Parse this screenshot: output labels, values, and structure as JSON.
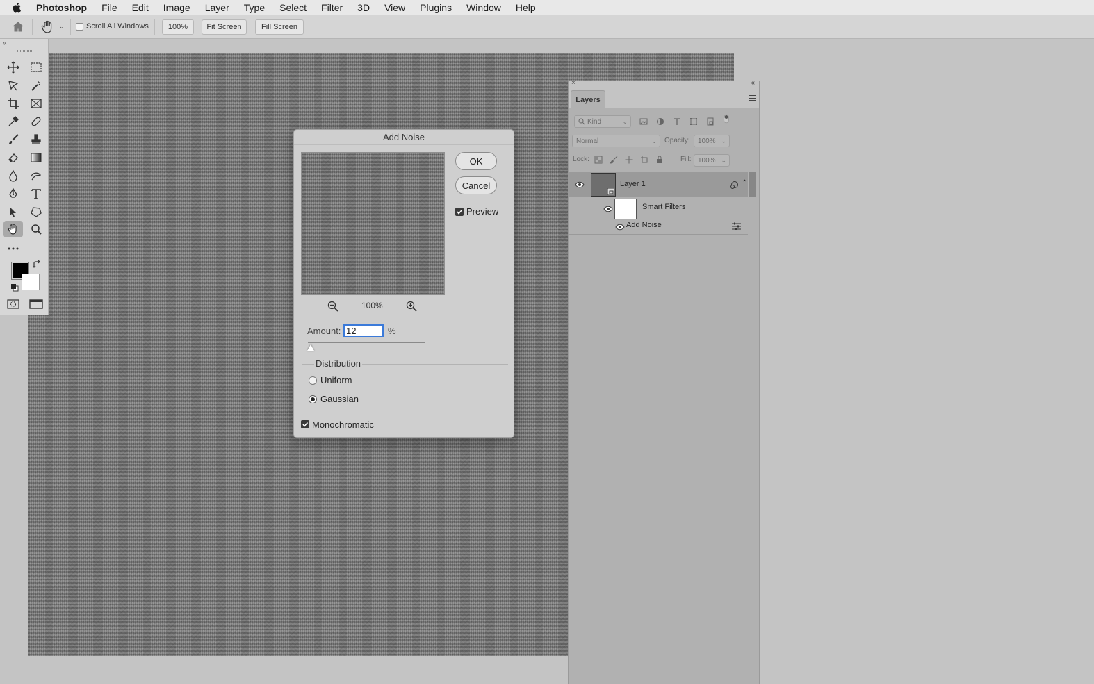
{
  "menubar": {
    "app_name": "Photoshop",
    "items": [
      "File",
      "Edit",
      "Image",
      "Layer",
      "Type",
      "Select",
      "Filter",
      "3D",
      "View",
      "Plugins",
      "Window",
      "Help"
    ]
  },
  "optionsbar": {
    "scroll_all_windows": "Scroll All Windows",
    "zoom_100": "100%",
    "fit_screen": "Fit Screen",
    "fill_screen": "Fill Screen"
  },
  "dialog": {
    "title": "Add Noise",
    "ok": "OK",
    "cancel": "Cancel",
    "preview": "Preview",
    "zoom_level": "100%",
    "amount_label": "Amount:",
    "amount_value": "12",
    "amount_unit": "%",
    "distribution_label": "Distribution",
    "uniform": "Uniform",
    "gaussian": "Gaussian",
    "selected_distribution": "Gaussian",
    "monochromatic": "Monochromatic",
    "preview_checked": true,
    "monochromatic_checked": true
  },
  "layers_panel": {
    "tab": "Layers",
    "filter_kind": "Kind",
    "blend_mode": "Normal",
    "opacity_label": "Opacity:",
    "opacity_value": "100%",
    "lock_label": "Lock:",
    "fill_label": "Fill:",
    "fill_value": "100%",
    "layers": [
      {
        "name": "Layer 1"
      }
    ],
    "smart_filters_label": "Smart Filters",
    "filter_name": "Add Noise"
  },
  "colors": {
    "foreground": "#000000",
    "background": "#ffffff",
    "accent": "#3b7ad9"
  }
}
